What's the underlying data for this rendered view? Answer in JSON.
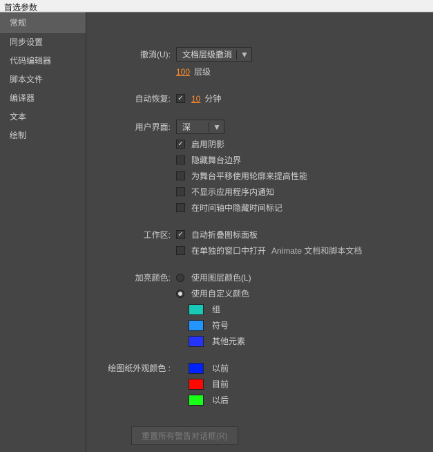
{
  "titlebar": "首选参数",
  "sidebar": {
    "items": [
      {
        "label": "常规"
      },
      {
        "label": "同步设置"
      },
      {
        "label": "代码编辑器"
      },
      {
        "label": "脚本文件"
      },
      {
        "label": "编译器"
      },
      {
        "label": "文本"
      },
      {
        "label": "绘制"
      }
    ]
  },
  "undo": {
    "label": "撤消(U):",
    "select_value": "文档层级撤消",
    "levels_value": "100",
    "levels_unit": "层级"
  },
  "autorecover": {
    "label": "自动恢复:",
    "minutes_value": "10",
    "minutes_unit": "分钟"
  },
  "ui": {
    "label": "用户界面:",
    "select_value": "深",
    "opt_shadow": "启用阴影",
    "opt_hide_stage_border": "隐藏舞台边界",
    "opt_outline_pan": "为舞台平移使用轮廓来提高性能",
    "opt_hide_notifications": "不显示应用程序内通知",
    "opt_hide_time_markers": "在时间轴中隐藏时间标记"
  },
  "workspace": {
    "label": "工作区:",
    "opt_collapse_icon_panel": "自动折叠图标面板",
    "opt_open_separate_prefix": "在单独的窗口中打开",
    "opt_open_separate_suffix": "Animate 文档和脚本文档"
  },
  "highlight": {
    "label": "加亮颜色:",
    "radio_layer": "使用图层颜色(L)",
    "radio_custom": "使用自定义颜色",
    "group_label": "组",
    "symbol_label": "符号",
    "other_label": "其他元素",
    "group_color": "#18c9b8",
    "symbol_color": "#2395ff",
    "other_color": "#2533ff"
  },
  "onionskin": {
    "label": "绘图纸外观颜色 :",
    "before_label": "以前",
    "current_label": "目前",
    "after_label": "以后",
    "before_color": "#0022ff",
    "current_color": "#ff0600",
    "after_color": "#17ff17"
  },
  "reset_button": "重置所有警告对话框(R)"
}
